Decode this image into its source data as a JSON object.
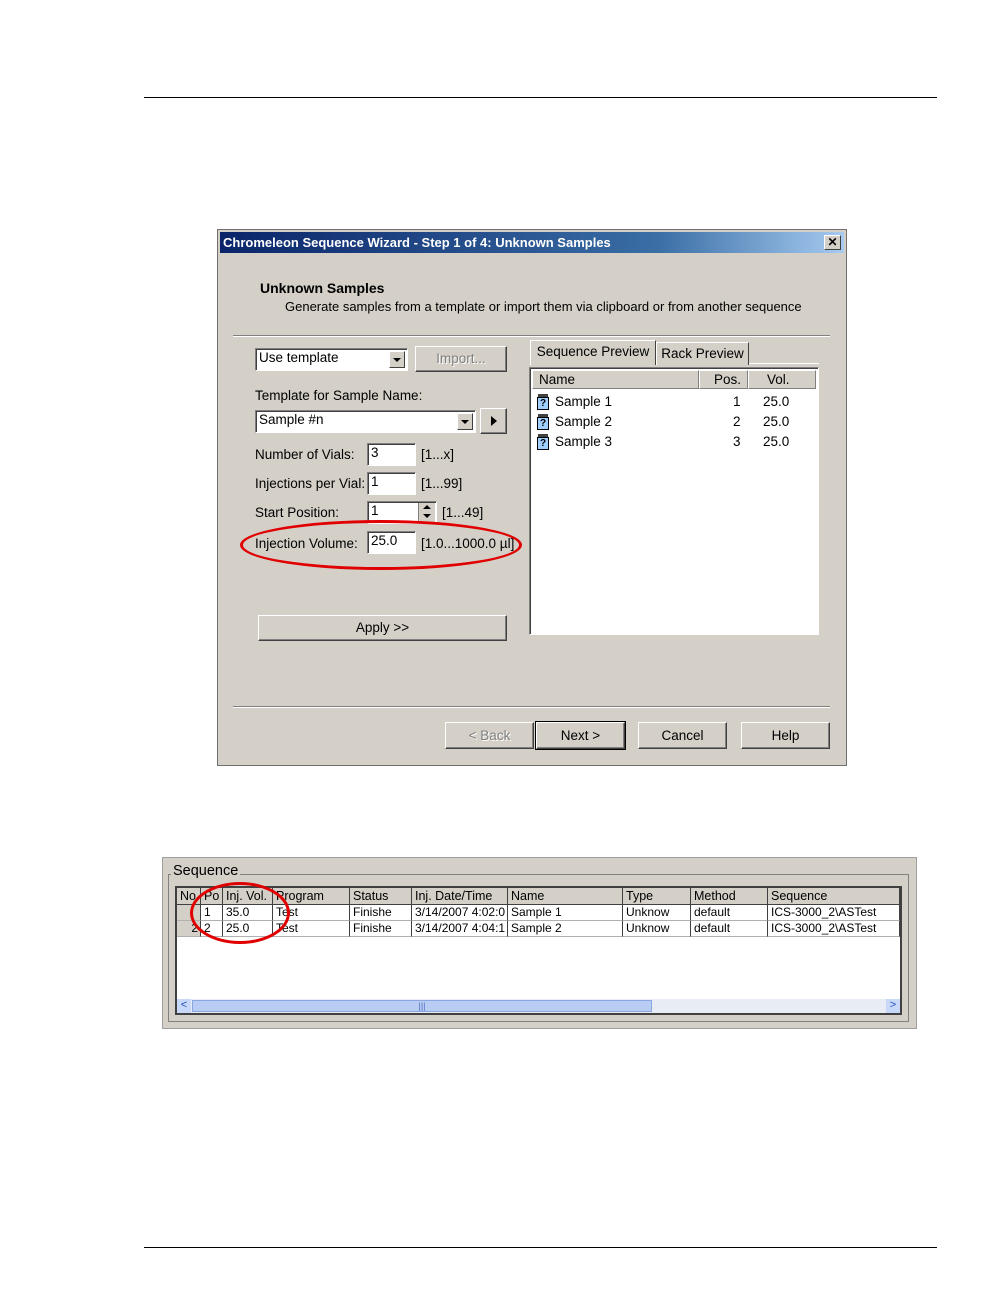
{
  "dialog": {
    "title": "Chromeleon Sequence Wizard - Step 1 of 4: Unknown Samples",
    "close_glyph": "✕",
    "heading": "Unknown Samples",
    "subheading": "Generate samples from a template or import them via clipboard or from another sequence",
    "source_select": "Use template",
    "import_button": "Import...",
    "template_label": "Template for Sample Name:",
    "template_value": "Sample #n",
    "fields": [
      {
        "label": "Number of Vials:",
        "value": "3",
        "range": "[1...x]"
      },
      {
        "label": "Injections per Vial:",
        "value": "1",
        "range": "[1...99]"
      },
      {
        "label": "Start Position:",
        "value": "1",
        "range": "[1...49]"
      },
      {
        "label": "Injection Volume:",
        "value": "25.0",
        "range": "[1.0...1000.0 µl]"
      }
    ],
    "apply_button": "Apply >>",
    "tabs": [
      "Sequence Preview",
      "Rack Preview"
    ],
    "preview_columns": [
      "Name",
      "Pos.",
      "Vol."
    ],
    "preview_rows": [
      {
        "name": "Sample 1",
        "pos": "1",
        "vol": "25.0"
      },
      {
        "name": "Sample 2",
        "pos": "2",
        "vol": "25.0"
      },
      {
        "name": "Sample 3",
        "pos": "3",
        "vol": "25.0"
      }
    ],
    "vial_icon_glyph": "?",
    "buttons": {
      "back": "< Back",
      "next": "Next >",
      "cancel": "Cancel",
      "help": "Help"
    }
  },
  "sequence": {
    "title": "Sequence",
    "columns": [
      "No.",
      "Po",
      "Inj. Vol.",
      "Program",
      "Status",
      "Inj. Date/Time",
      "Name",
      "Type",
      "Method",
      "Sequence"
    ],
    "rows": [
      {
        "no": "",
        "pos": "1",
        "inj_vol": "35.0",
        "program": "Test",
        "status": "Finishe",
        "datetime": "3/14/2007 4:02:0",
        "name": "Sample 1",
        "type": "Unknow",
        "method": "default",
        "sequence": "ICS-3000_2\\ASTest"
      },
      {
        "no": "2",
        "pos": "2",
        "inj_vol": "25.0",
        "program": "Test",
        "status": "Finishe",
        "datetime": "3/14/2007 4:04:1",
        "name": "Sample 2",
        "type": "Unknow",
        "method": "default",
        "sequence": "ICS-3000_2\\ASTest"
      }
    ],
    "scroll_left": "<",
    "scroll_right": ">",
    "scroll_grip": "|||"
  },
  "colors": {
    "highlight_ring": "#e00000",
    "titlebar": "#0a246a"
  }
}
